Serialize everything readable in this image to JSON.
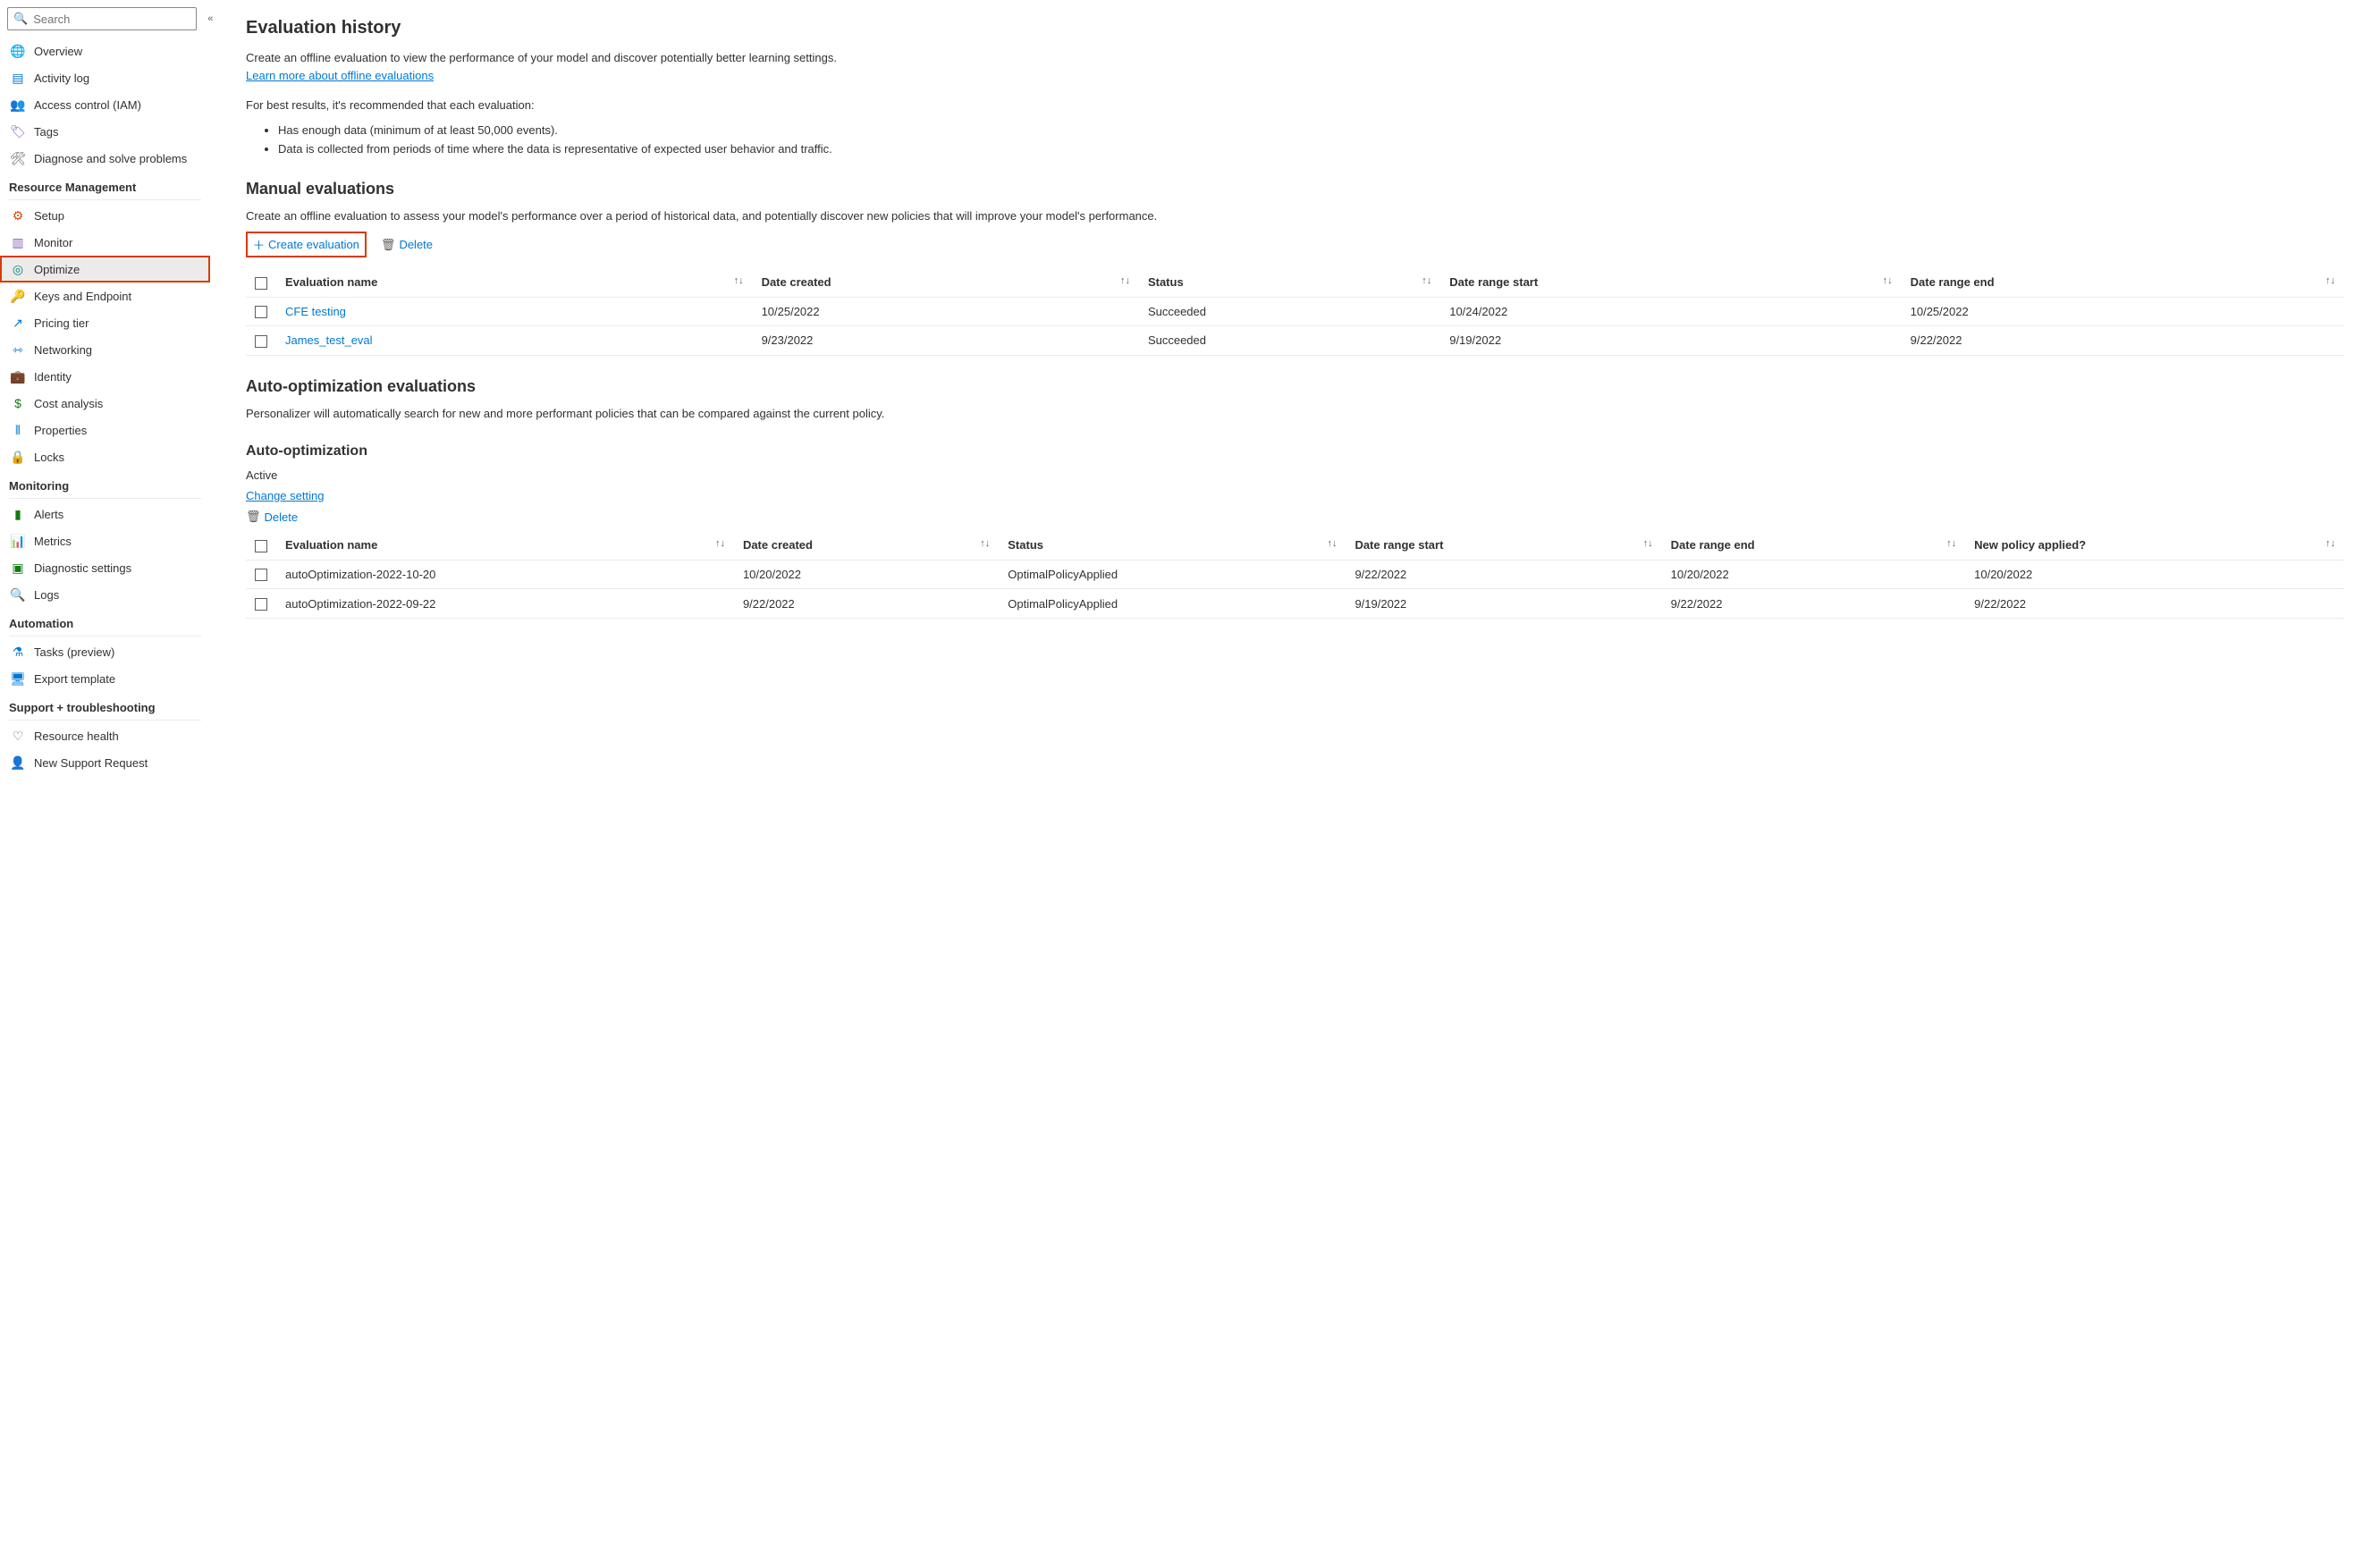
{
  "search": {
    "placeholder": "Search"
  },
  "sidebar": {
    "top": [
      {
        "label": "Overview",
        "icon": "🌐",
        "cls": "i-blue"
      },
      {
        "label": "Activity log",
        "icon": "▤",
        "cls": "i-blue"
      },
      {
        "label": "Access control (IAM)",
        "icon": "👥",
        "cls": "i-blue"
      },
      {
        "label": "Tags",
        "icon": "🏷",
        "cls": "i-purple"
      },
      {
        "label": "Diagnose and solve problems",
        "icon": "🛠",
        "cls": "i-gray"
      }
    ],
    "sections": [
      {
        "title": "Resource Management",
        "items": [
          {
            "label": "Setup",
            "icon": "⚙",
            "cls": "i-orange"
          },
          {
            "label": "Monitor",
            "icon": "▥",
            "cls": "i-purple"
          },
          {
            "label": "Optimize",
            "icon": "◎",
            "cls": "i-teal",
            "active": true
          },
          {
            "label": "Keys and Endpoint",
            "icon": "🔑",
            "cls": "i-yellow"
          },
          {
            "label": "Pricing tier",
            "icon": "↗",
            "cls": "i-blue"
          },
          {
            "label": "Networking",
            "icon": "⇿",
            "cls": "i-blue"
          },
          {
            "label": "Identity",
            "icon": "💼",
            "cls": "i-blue"
          },
          {
            "label": "Cost analysis",
            "icon": "$",
            "cls": "i-green"
          },
          {
            "label": "Properties",
            "icon": "⦀",
            "cls": "i-blue"
          },
          {
            "label": "Locks",
            "icon": "🔒",
            "cls": "i-blue"
          }
        ]
      },
      {
        "title": "Monitoring",
        "items": [
          {
            "label": "Alerts",
            "icon": "▮",
            "cls": "i-green"
          },
          {
            "label": "Metrics",
            "icon": "📊",
            "cls": "i-blue"
          },
          {
            "label": "Diagnostic settings",
            "icon": "▣",
            "cls": "i-green"
          },
          {
            "label": "Logs",
            "icon": "🔍",
            "cls": "i-blue"
          }
        ]
      },
      {
        "title": "Automation",
        "items": [
          {
            "label": "Tasks (preview)",
            "icon": "⚗",
            "cls": "i-blue"
          },
          {
            "label": "Export template",
            "icon": "🖥",
            "cls": "i-blue"
          }
        ]
      },
      {
        "title": "Support + troubleshooting",
        "items": [
          {
            "label": "Resource health",
            "icon": "♡",
            "cls": "i-gray"
          },
          {
            "label": "New Support Request",
            "icon": "👤",
            "cls": "i-blue"
          }
        ]
      }
    ]
  },
  "main": {
    "title": "Evaluation history",
    "intro1": "Create an offline evaluation to view the performance of your model and discover potentially better learning settings.",
    "learn_link": "Learn more about offline evaluations",
    "intro2": "For best results, it's recommended that each evaluation:",
    "bullets": [
      "Has enough data (minimum of at least 50,000 events).",
      "Data is collected from periods of time where the data is representative of expected user behavior and traffic."
    ],
    "manual": {
      "title": "Manual evaluations",
      "desc": "Create an offline evaluation to assess your model's performance over a period of historical data, and potentially discover new policies that will improve your model's performance.",
      "create": "Create evaluation",
      "delete": "Delete",
      "cols": [
        "Evaluation name",
        "Date created",
        "Status",
        "Date range start",
        "Date range end"
      ],
      "rows": [
        {
          "name": "CFE testing",
          "created": "10/25/2022",
          "status": "Succeeded",
          "start": "10/24/2022",
          "end": "10/25/2022"
        },
        {
          "name": "James_test_eval",
          "created": "9/23/2022",
          "status": "Succeeded",
          "start": "9/19/2022",
          "end": "9/22/2022"
        }
      ]
    },
    "autoopt": {
      "title": "Auto-optimization evaluations",
      "desc": "Personalizer will automatically search for new and more performant policies that can be compared against the current policy.",
      "subtitle": "Auto-optimization",
      "status": "Active",
      "change": "Change setting",
      "delete": "Delete",
      "cols": [
        "Evaluation name",
        "Date created",
        "Status",
        "Date range start",
        "Date range end",
        "New policy applied?"
      ],
      "rows": [
        {
          "name": "autoOptimization-2022-10-20",
          "created": "10/20/2022",
          "status": "OptimalPolicyApplied",
          "start": "9/22/2022",
          "end": "10/20/2022",
          "applied": "10/20/2022"
        },
        {
          "name": "autoOptimization-2022-09-22",
          "created": "9/22/2022",
          "status": "OptimalPolicyApplied",
          "start": "9/19/2022",
          "end": "9/22/2022",
          "applied": "9/22/2022"
        }
      ]
    }
  }
}
